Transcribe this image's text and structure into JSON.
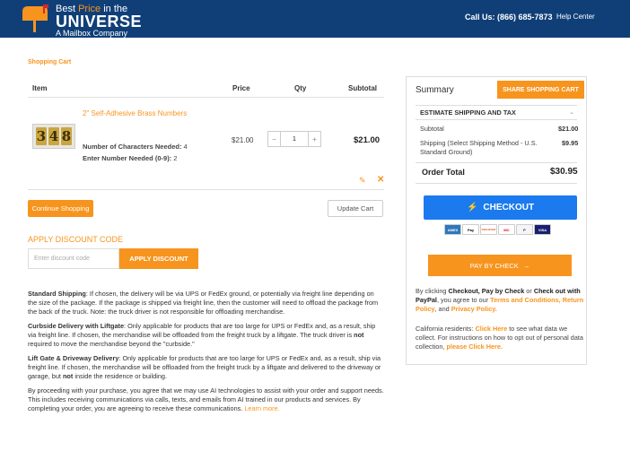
{
  "header": {
    "brand_l1_a": "Best ",
    "brand_l1_b": "Price",
    "brand_l1_c": " in the",
    "brand_l2": "UNIVERSE",
    "brand_l3": "A Mailbox Company",
    "call": "Call Us: (866) 685-7873",
    "help": "Help Center"
  },
  "page": {
    "title": "Shopping Cart"
  },
  "table": {
    "headers": {
      "item": "Item",
      "price": "Price",
      "qty": "Qty",
      "subtotal": "Subtotal"
    },
    "item": {
      "name": "2\" Self-Adhesive Brass Numbers",
      "image_digits": [
        "3",
        "4",
        "8"
      ],
      "opt1_label": "Number of Characters Needed:",
      "opt1_value": "4",
      "opt2_label": "Enter Number Needed (0-9):",
      "opt2_value": "2",
      "price": "$21.00",
      "qty_minus": "−",
      "qty": "1",
      "qty_plus": "+",
      "subtotal": "$21.00"
    }
  },
  "actions": {
    "continue": "Continue Shopping",
    "update": "Update Cart"
  },
  "discount": {
    "title": "APPLY DISCOUNT CODE",
    "placeholder": "Enter discount code",
    "button": "APPLY DISCOUNT"
  },
  "notes": {
    "standard_title": "Standard Shipping",
    "standard_body": ": If chosen, the delivery will be via UPS or FedEx ground, or potentially via freight line depending on the size of the package. If the package is shipped via freight line, then the customer will need to offload the package from the back of the truck. Note: the truck driver is not responsible for offloading merchandise.",
    "curbside_title": "Curbside Delivery with Liftgate",
    "curbside_body_a": ": Only applicable for products that are too large for UPS or FedEx and, as a result, ship via freight line. If chosen, the merchandise will be offloaded from the freight truck by a liftgate. The truck driver is ",
    "curbside_not": "not",
    "curbside_body_b": " required to move the merchandise beyond the \"curbside.\"",
    "liftgate_title": "Lift Gate & Driveway Delivery",
    "liftgate_body_a": ": Only applicable for products that are too large for UPS or FedEx and, as a result, ship via freight line. If chosen, the merchandise will be offloaded from the freight truck by a liftgate and delivered to the driveway or garage, but ",
    "liftgate_not": "not",
    "liftgate_body_b": " inside the residence or building.",
    "ai_body": "By proceeding with your purchase, you agree that we may use AI technologies to assist with your order and support needs. This includes receiving communications via calls, texts, and emails from AI trained in our products and services. By completing your order, you are agreeing to receive these communications. ",
    "ai_link": "Learn more."
  },
  "summary": {
    "title": "Summary",
    "share": "SHARE SHOPPING CART",
    "estimate": "ESTIMATE SHIPPING AND TAX",
    "subtotal_label": "Subtotal",
    "subtotal_value": "$21.00",
    "shipping_label": "Shipping (Select Shipping Method - U.S. Standard Ground)",
    "shipping_value": "$9.95",
    "total_label": "Order Total",
    "total_value": "$30.95",
    "checkout": "CHECKOUT",
    "cards": [
      "AMEX",
      "Pay",
      "DISCOVER",
      "MC",
      "P",
      "VISA"
    ],
    "paycheck": "PAY BY CHECK",
    "terms_a": "By clicking ",
    "terms_b": "Checkout, Pay by Check",
    "terms_c": " or ",
    "terms_d": "Check out with PayPal",
    "terms_e": ", you agree to our ",
    "terms_f": "Terms and Conditions, Return Policy",
    "terms_g": ", and ",
    "terms_h": "Privacy Policy.",
    "ca_a": "California residents: ",
    "ca_b": "Click Here",
    "ca_c": " to see what data we collect. For instructions on how to opt out of personal data collection, ",
    "ca_d": "please Click Here."
  },
  "colors": {
    "header": "#103f78",
    "accent": "#f7941d",
    "checkout": "#1a7aee"
  }
}
